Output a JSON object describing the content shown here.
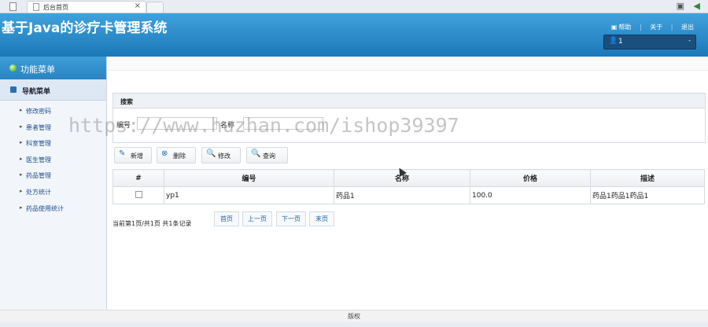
{
  "browser": {
    "tab_title": "后台首页",
    "tab_close": "×"
  },
  "header": {
    "app_title": "基于Java的诊疗卡管理系统",
    "links": [
      "帮助",
      "关于",
      "退出"
    ],
    "user_value": "1"
  },
  "sidebar": {
    "menu_title": "功能菜单",
    "nav_title": "导航菜单",
    "items": [
      "修改密码",
      "患者管理",
      "科室管理",
      "医生管理",
      "药品管理",
      "处方统计",
      "药品使用统计"
    ]
  },
  "search": {
    "title": "搜索",
    "fields": [
      {
        "label": "编号",
        "value": ""
      },
      {
        "label": "名称",
        "value": ""
      }
    ]
  },
  "toolbar": {
    "add": "新增",
    "delete": "删除",
    "edit": "修改",
    "query": "查询"
  },
  "table": {
    "columns": [
      "#",
      "编号",
      "名称",
      "价格",
      "描述"
    ],
    "rows": [
      {
        "id": "yp1",
        "name": "药品1",
        "price": "100.0",
        "desc": "药品1药品1药品1"
      }
    ]
  },
  "pager": {
    "info": "当前第1页/共1页 共1条记录",
    "first": "首页",
    "prev": "上一页",
    "next": "下一页",
    "last": "末页"
  },
  "watermark": "https://www.huzhan.com/ishop39397",
  "footer": "版权",
  "colors": {
    "header_top": "#3fa2dd",
    "header_bottom": "#1c78b8",
    "nav_link": "#1f4e8c"
  }
}
